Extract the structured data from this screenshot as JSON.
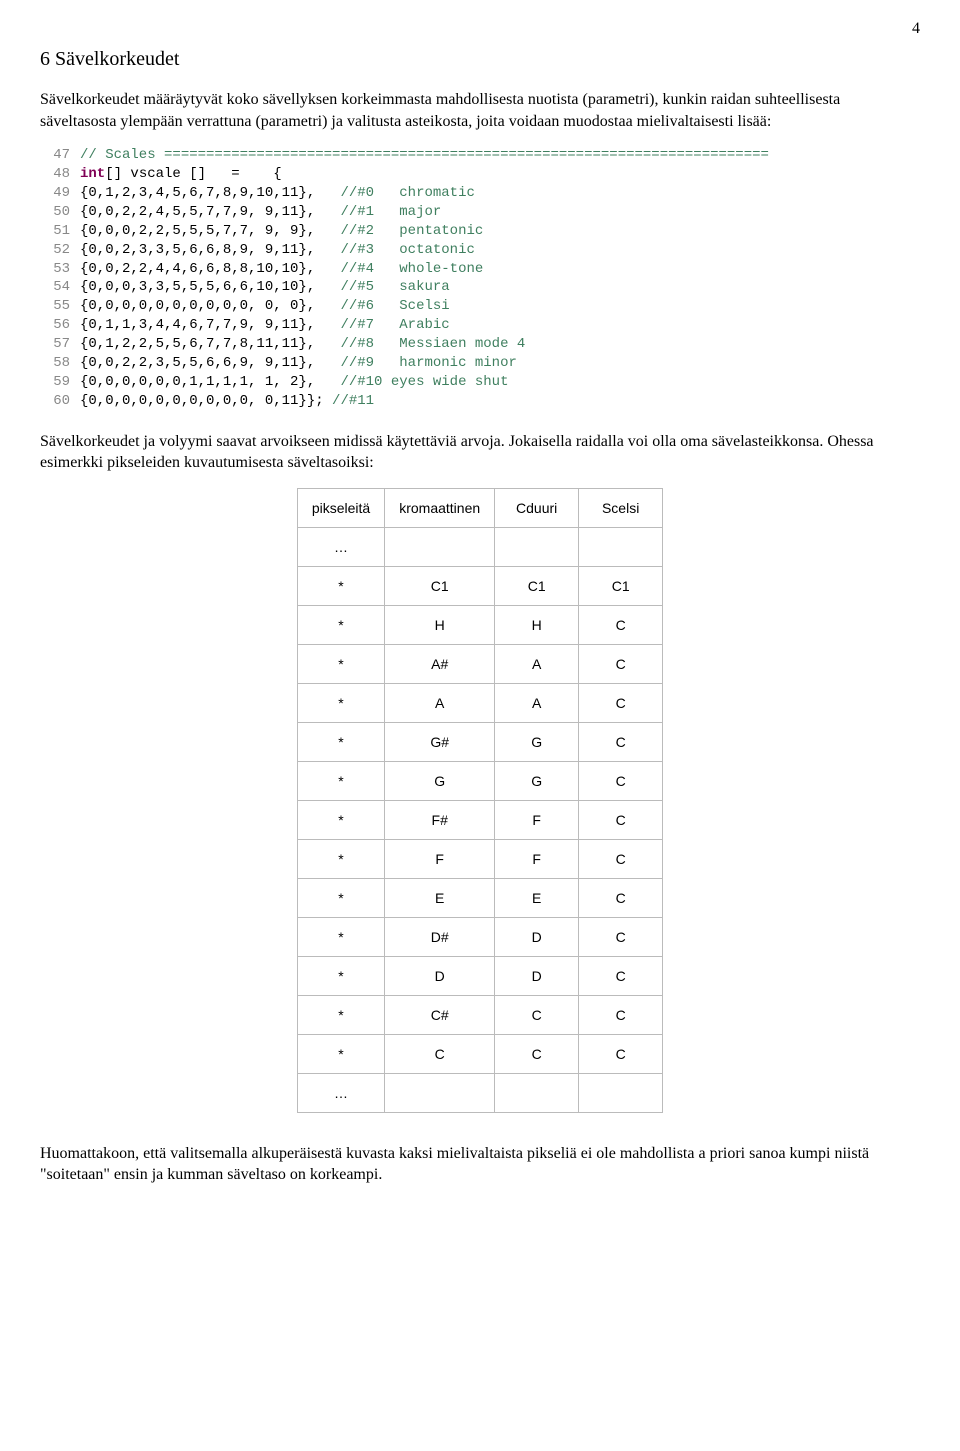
{
  "page_number": "4",
  "heading": "6 Sävelkorkeudet",
  "para1": "Sävelkorkeudet määräytyvät koko sävellyksen korkeimmasta mahdollisesta nuotista (parametri), kunkin raidan suhteellisesta säveltasosta ylempään verrattuna (parametri) ja valitusta asteikosta, joita voidaan muodostaa mielivaltaisesti lisää:",
  "code": {
    "lines": [
      {
        "n": "47",
        "kw": "",
        "pl": "",
        "cm": "// Scales ========================================================================"
      },
      {
        "n": "48",
        "kw": "int",
        "pl": "[] vscale []   =    {",
        "cm": ""
      },
      {
        "n": "49",
        "kw": "",
        "pl": "{0,1,2,3,4,5,6,7,8,9,10,11},   ",
        "cm": "//#0   chromatic"
      },
      {
        "n": "50",
        "kw": "",
        "pl": "{0,0,2,2,4,5,5,7,7,9, 9,11},   ",
        "cm": "//#1   major"
      },
      {
        "n": "51",
        "kw": "",
        "pl": "{0,0,0,2,2,5,5,5,7,7, 9, 9},   ",
        "cm": "//#2   pentatonic"
      },
      {
        "n": "52",
        "kw": "",
        "pl": "{0,0,2,3,3,5,6,6,8,9, 9,11},   ",
        "cm": "//#3   octatonic"
      },
      {
        "n": "53",
        "kw": "",
        "pl": "{0,0,2,2,4,4,6,6,8,8,10,10},   ",
        "cm": "//#4   whole-tone"
      },
      {
        "n": "54",
        "kw": "",
        "pl": "{0,0,0,3,3,5,5,5,6,6,10,10},   ",
        "cm": "//#5   sakura"
      },
      {
        "n": "55",
        "kw": "",
        "pl": "{0,0,0,0,0,0,0,0,0,0, 0, 0},   ",
        "cm": "//#6   Scelsi"
      },
      {
        "n": "56",
        "kw": "",
        "pl": "{0,1,1,3,4,4,6,7,7,9, 9,11},   ",
        "cm": "//#7   Arabic"
      },
      {
        "n": "57",
        "kw": "",
        "pl": "{0,1,2,2,5,5,6,7,7,8,11,11},   ",
        "cm": "//#8   Messiaen mode 4"
      },
      {
        "n": "58",
        "kw": "",
        "pl": "{0,0,2,2,3,5,5,6,6,9, 9,11},   ",
        "cm": "//#9   harmonic minor"
      },
      {
        "n": "59",
        "kw": "",
        "pl": "{0,0,0,0,0,0,1,1,1,1, 1, 2},   ",
        "cm": "//#10 eyes wide shut"
      },
      {
        "n": "60",
        "kw": "",
        "pl": "{0,0,0,0,0,0,0,0,0,0, 0,11}}; ",
        "cm": "//#11"
      }
    ]
  },
  "para2": "Sävelkorkeudet ja volyymi saavat arvoikseen midissä käytettäviä arvoja. Jokaisella raidalla voi olla oma sävelasteikkonsa. Ohessa esimerkki pikseleiden kuvautumisesta säveltasoiksi:",
  "table": {
    "headers": [
      "pikseleitä",
      "kromaattinen",
      "Cduuri",
      "Scelsi"
    ],
    "rows": [
      [
        "…",
        "",
        "",
        ""
      ],
      [
        "*",
        "C1",
        "C1",
        "C1"
      ],
      [
        "*",
        "H",
        "H",
        "C"
      ],
      [
        "*",
        "A#",
        "A",
        "C"
      ],
      [
        "*",
        "A",
        "A",
        "C"
      ],
      [
        "*",
        "G#",
        "G",
        "C"
      ],
      [
        "*",
        "G",
        "G",
        "C"
      ],
      [
        "*",
        "F#",
        "F",
        "C"
      ],
      [
        "*",
        "F",
        "F",
        "C"
      ],
      [
        "*",
        "E",
        "E",
        "C"
      ],
      [
        "*",
        "D#",
        "D",
        "C"
      ],
      [
        "*",
        "D",
        "D",
        "C"
      ],
      [
        "*",
        "C#",
        "C",
        "C"
      ],
      [
        "*",
        "C",
        "C",
        "C"
      ],
      [
        "…",
        "",
        "",
        ""
      ]
    ]
  },
  "para3": "Huomattakoon, että valitsemalla alkuperäisestä kuvasta kaksi mielivaltaista pikseliä ei ole mahdollista a priori sanoa kumpi niistä \"soitetaan\" ensin ja kumman säveltaso on korkeampi."
}
